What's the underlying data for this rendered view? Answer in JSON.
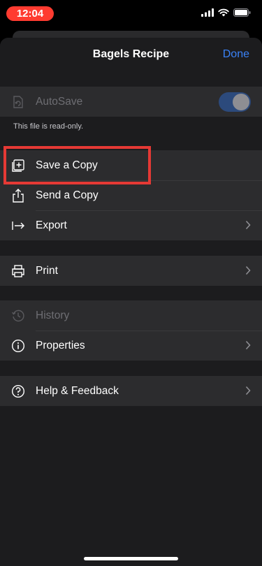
{
  "status_bar": {
    "time": "12:04",
    "time_pill_color": "#ff3b30",
    "icons": [
      "cellular-signal-icon",
      "wifi-icon",
      "battery-icon"
    ]
  },
  "sheet": {
    "title": "Bagels Recipe",
    "done_label": "Done",
    "accent_color": "#3a82f7"
  },
  "autosave": {
    "label": "AutoSave",
    "enabled": true,
    "disabled_row": true,
    "footnote": "This file is read-only."
  },
  "file_actions": [
    {
      "label": "Save a Copy",
      "icon": "save-copy-icon",
      "chevron": false,
      "highlighted": true
    },
    {
      "label": "Send a Copy",
      "icon": "share-icon",
      "chevron": false
    },
    {
      "label": "Export",
      "icon": "export-arrow-icon",
      "chevron": true
    }
  ],
  "print": {
    "label": "Print",
    "icon": "printer-icon",
    "chevron": true
  },
  "info_actions": [
    {
      "label": "History",
      "icon": "history-clock-icon",
      "chevron": false,
      "disabled": true
    },
    {
      "label": "Properties",
      "icon": "info-icon",
      "chevron": true
    }
  ],
  "help": {
    "label": "Help & Feedback",
    "icon": "help-question-icon",
    "chevron": true
  },
  "annotation": {
    "color": "#e53935",
    "target": "Save a Copy"
  }
}
